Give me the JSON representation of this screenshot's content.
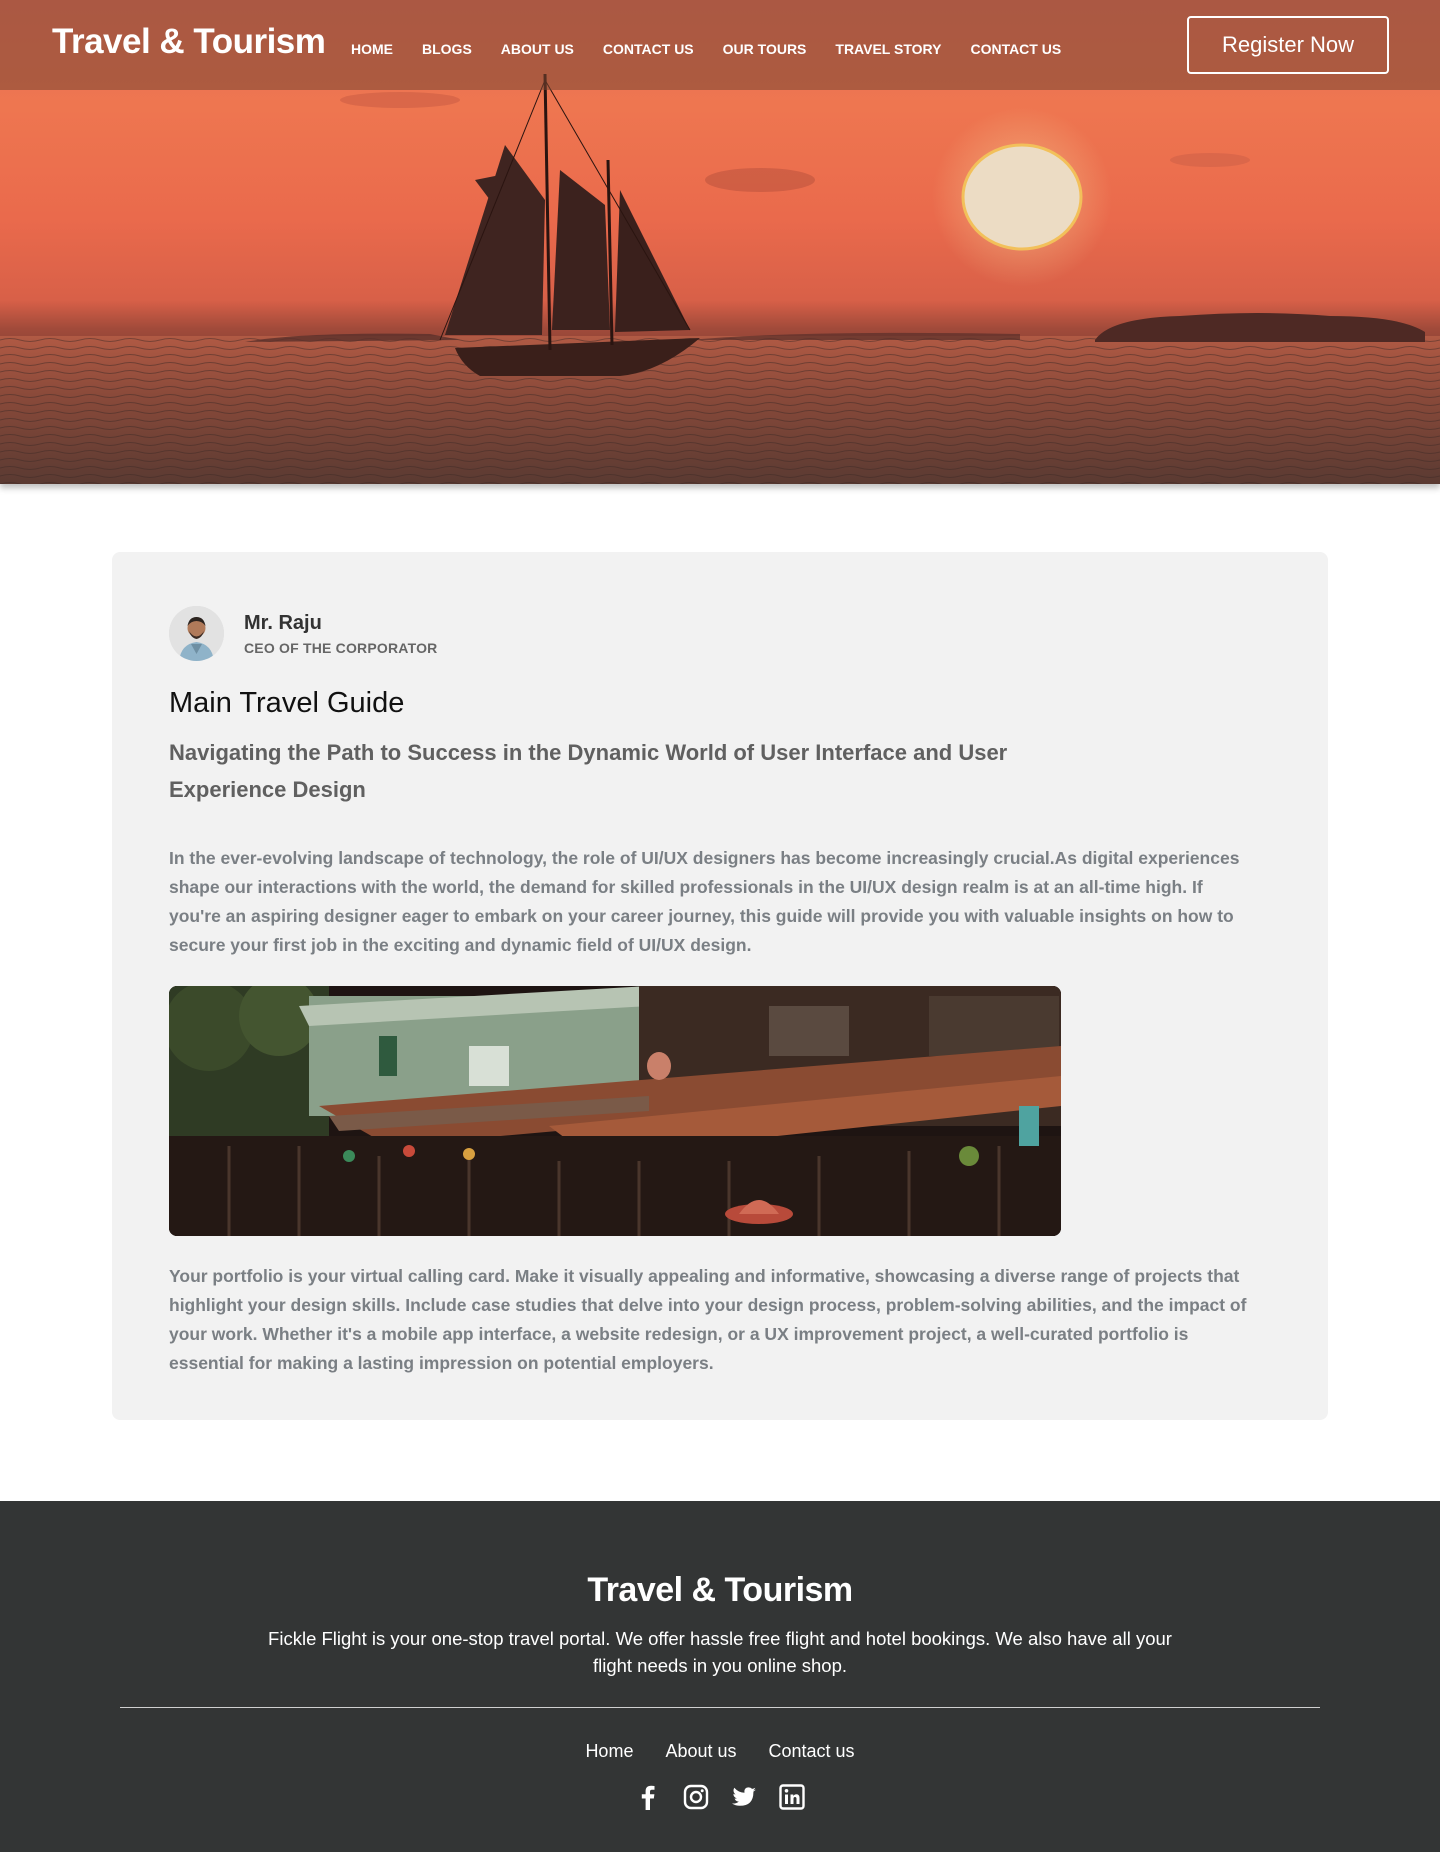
{
  "header": {
    "brand": "Travel & Tourism",
    "nav": [
      "HOME",
      "BLOGS",
      "ABOUT US",
      "CONTACT US",
      "OUR TOURS",
      "TRAVEL STORY",
      "CONTACT US"
    ],
    "register_label": "Register Now"
  },
  "article": {
    "author_name": "Mr. Raju",
    "author_role": "CEO OF THE CORPORATOR",
    "title": "Main Travel Guide",
    "subtitle": "Navigating the Path to Success in the Dynamic World of User Interface and User Experience Design",
    "paragraph1": "In the ever-evolving landscape of technology, the role of UI/UX designers has become increasingly crucial.As digital experiences shape our interactions with the world, the demand for skilled professionals in the UI/UX design realm is at an all-time high. If you're an aspiring designer eager to embark on your career journey, this guide will provide you with valuable insights on how to secure your first job in the exciting and dynamic field of UI/UX design.",
    "paragraph2": "Your portfolio is your virtual calling card. Make it visually appealing and informative, showcasing a diverse range of projects that highlight your design skills. Include case studies that delve into your design process, problem-solving abilities, and the impact of your work. Whether it's a mobile app interface, a website redesign, or a UX improvement project, a well-curated portfolio is essential for making a lasting impression on potential employers."
  },
  "footer": {
    "brand": "Travel & Tourism",
    "description": "Fickle Flight is your one-stop travel portal. We offer hassle free flight and hotel bookings. We also have all your flight needs in you online shop.",
    "links": [
      "Home",
      "About  us",
      "Contact us"
    ],
    "socials": [
      "facebook-icon",
      "instagram-icon",
      "twitter-icon",
      "linkedin-icon"
    ]
  },
  "colors": {
    "accent_sunset": "#ea6a4c",
    "card_bg": "#f2f2f2",
    "footer_bg": "#333535"
  }
}
